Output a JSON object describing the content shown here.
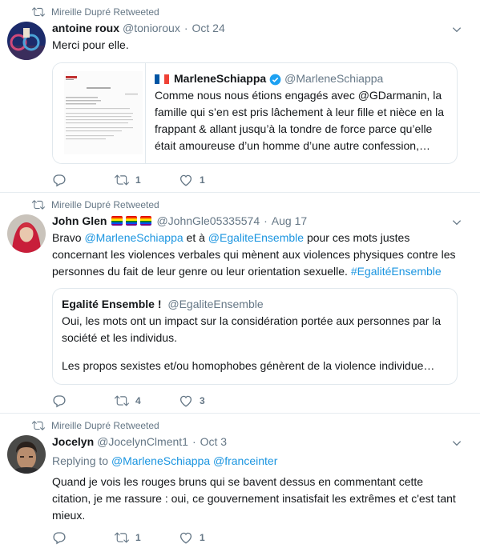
{
  "tweets": [
    {
      "retweet_label": "Mireille Dupré Retweeted",
      "name": "antoine roux",
      "handle": "@tonioroux",
      "date": "Oct 24",
      "text": "Merci pour elle.",
      "quote": {
        "name": "MarleneSchiappa",
        "handle": "@MarleneSchiappa",
        "text": "Comme nous nous étions engagés avec @GDarmanin, la famille qui s’en est pris lâchement à leur fille et nièce en la frappant & allant jusqu’à la tondre de force parce qu’elle était amoureuse d’un homme d’une autre confession,…"
      },
      "reply_count": "",
      "retweet_count": "1",
      "like_count": "1"
    },
    {
      "retweet_label": "Mireille Dupré Retweeted",
      "name": "John Glen",
      "handle": "@JohnGle05335574",
      "date": "Aug 17",
      "text_parts": [
        "Bravo ",
        "@MarleneSchiappa",
        " et à ",
        "@EgaliteEnsemble",
        " pour ces mots justes concernant les violences verbales qui mènent aux violences physiques contre les personnes du fait de leur genre ou leur orientation sexuelle. ",
        "#EgalitéEnsemble"
      ],
      "quote": {
        "name": "Egalité Ensemble !",
        "handle": "@EgaliteEnsemble",
        "line1": "Oui, les mots ont un impact sur la considération portée aux personnes par la société et les individus.",
        "line2": "Les propos sexistes et/ou homophobes génèrent de la violence individue…"
      },
      "reply_count": "",
      "retweet_count": "4",
      "like_count": "3"
    },
    {
      "retweet_label": "Mireille Dupré Retweeted",
      "name": "Jocelyn",
      "handle": "@JocelynClment1",
      "date": "Oct 3",
      "replying_to": "Replying to",
      "reply_handle1": "@MarleneSchiappa",
      "reply_handle2": "@franceinter",
      "text": "Quand je vois les rouges bruns qui se bavent dessus en commentant cette citation, je me rassure : oui, ce gouvernement insatisfait les extrêmes et c'est tant mieux.",
      "reply_count": "",
      "retweet_count": "1",
      "like_count": "1"
    }
  ],
  "colors": {
    "link": "#1b95e0",
    "muted": "#657786",
    "border": "#e1e8ed",
    "verified": "#1da1f2"
  }
}
